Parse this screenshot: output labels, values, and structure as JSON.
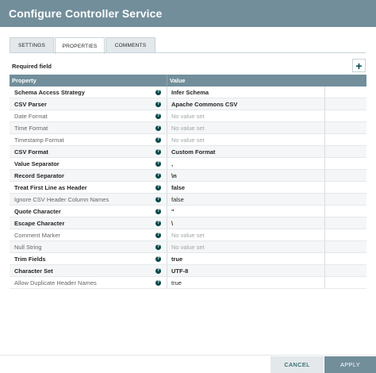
{
  "dialog": {
    "title": "Configure Controller Service"
  },
  "tabs": [
    {
      "label": "SETTINGS",
      "active": false
    },
    {
      "label": "PROPERTIES",
      "active": true
    },
    {
      "label": "COMMENTS",
      "active": false
    }
  ],
  "properties_panel": {
    "required_field_label": "Required field",
    "add_icon": "plus-icon",
    "add_glyph": "+",
    "info_glyph": "?",
    "columns": {
      "property": "Property",
      "value": "Value"
    },
    "rows": [
      {
        "name": "Schema Access Strategy",
        "value": "Infer Schema",
        "required": true,
        "is_set": true
      },
      {
        "name": "CSV Parser",
        "value": "Apache Commons CSV",
        "required": true,
        "is_set": true
      },
      {
        "name": "Date Format",
        "value": "No value set",
        "required": false,
        "is_set": false
      },
      {
        "name": "Time Format",
        "value": "No value set",
        "required": false,
        "is_set": false
      },
      {
        "name": "Timestamp Format",
        "value": "No value set",
        "required": false,
        "is_set": false
      },
      {
        "name": "CSV Format",
        "value": "Custom Format",
        "required": true,
        "is_set": true
      },
      {
        "name": "Value Separator",
        "value": ",",
        "required": true,
        "is_set": true
      },
      {
        "name": "Record Separator",
        "value": "\\n",
        "required": true,
        "is_set": true
      },
      {
        "name": "Treat First Line as Header",
        "value": "false",
        "required": true,
        "is_set": true
      },
      {
        "name": "Ignore CSV Header Column Names",
        "value": "false",
        "required": false,
        "is_set": true
      },
      {
        "name": "Quote Character",
        "value": "\"",
        "required": true,
        "is_set": true
      },
      {
        "name": "Escape Character",
        "value": "\\",
        "required": true,
        "is_set": true
      },
      {
        "name": "Comment Marker",
        "value": "No value set",
        "required": false,
        "is_set": false
      },
      {
        "name": "Null String",
        "value": "No value set",
        "required": false,
        "is_set": false
      },
      {
        "name": "Trim Fields",
        "value": "true",
        "required": true,
        "is_set": true
      },
      {
        "name": "Character Set",
        "value": "UTF-8",
        "required": true,
        "is_set": true
      },
      {
        "name": "Allow Duplicate Header Names",
        "value": "true",
        "required": false,
        "is_set": true
      }
    ]
  },
  "footer": {
    "cancel_label": "CANCEL",
    "apply_label": "APPLY"
  },
  "colors": {
    "header_bg": "#728e9b",
    "accent": "#004849",
    "tab_bg": "#e3e8eb"
  }
}
